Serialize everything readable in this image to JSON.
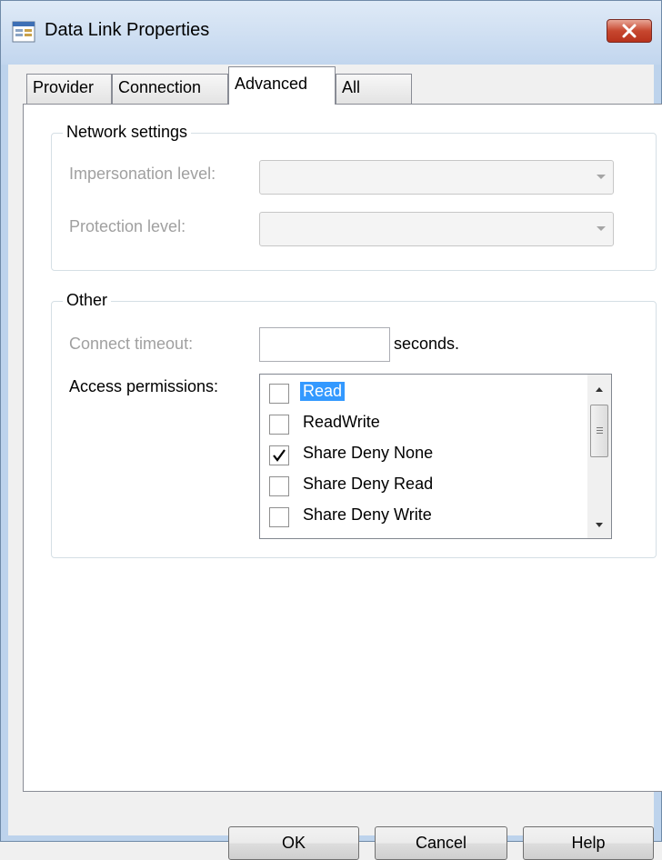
{
  "window": {
    "title": "Data Link Properties",
    "icon": "data-link-icon",
    "close_icon": "close-x-icon"
  },
  "tabs": [
    {
      "label": "Provider",
      "active": false
    },
    {
      "label": "Connection",
      "active": false
    },
    {
      "label": "Advanced",
      "active": true
    },
    {
      "label": "All",
      "active": false
    }
  ],
  "network_settings": {
    "title": "Network settings",
    "impersonation_label": "Impersonation level:",
    "impersonation_value": "",
    "protection_label": "Protection level:",
    "protection_value": ""
  },
  "other": {
    "title": "Other",
    "timeout_label": "Connect timeout:",
    "timeout_value": "",
    "timeout_unit": "seconds.",
    "access_label": "Access permissions:",
    "access_items": [
      {
        "label": "Read",
        "checked": false,
        "selected": true
      },
      {
        "label": "ReadWrite",
        "checked": false,
        "selected": false
      },
      {
        "label": "Share Deny None",
        "checked": true,
        "selected": false
      },
      {
        "label": "Share Deny Read",
        "checked": false,
        "selected": false
      },
      {
        "label": "Share Deny Write",
        "checked": false,
        "selected": false
      }
    ]
  },
  "buttons": {
    "ok": "OK",
    "cancel": "Cancel",
    "help": "Help"
  },
  "colors": {
    "selection": "#3399ff",
    "disabled_text": "#a0a0a0",
    "close_button": "#c7472f"
  }
}
